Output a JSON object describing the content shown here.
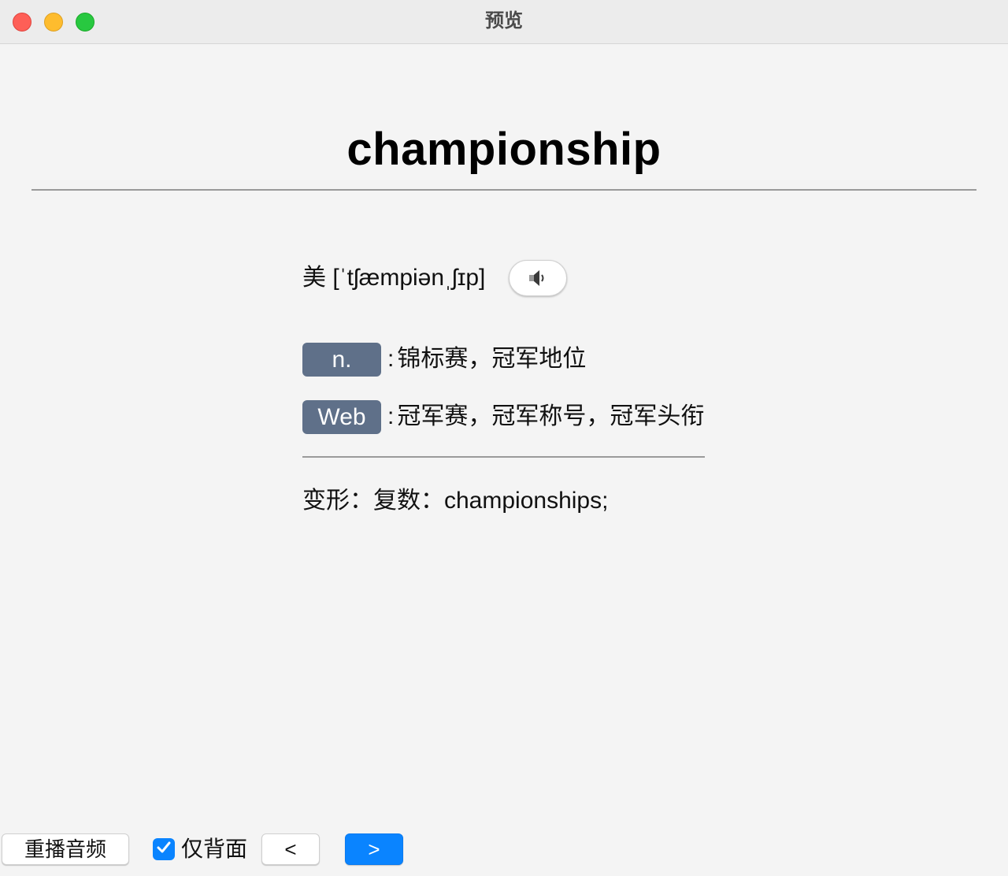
{
  "window": {
    "title": "预览",
    "controls": [
      "close",
      "minimize",
      "maximize"
    ]
  },
  "card": {
    "word": "championship",
    "pronunciation": {
      "text": "美 [ˈtʃæmpiənˌʃɪp]",
      "speak_icon": "speaker-icon"
    },
    "definitions": [
      {
        "pos": "n.",
        "separator": ":",
        "text": "锦标赛，冠军地位"
      },
      {
        "pos": "Web",
        "separator": ":",
        "text": "冠军赛，冠军称号，冠军头衔"
      }
    ],
    "forms": "变形：复数：championships;"
  },
  "toolbar": {
    "replay_label": "重播音频",
    "back_only_label": "仅背面",
    "back_only_checked": true,
    "prev_label": "<",
    "next_label": ">"
  },
  "colors": {
    "accent": "#0a84ff",
    "badge": "#5f7089",
    "background": "#f4f4f4"
  }
}
